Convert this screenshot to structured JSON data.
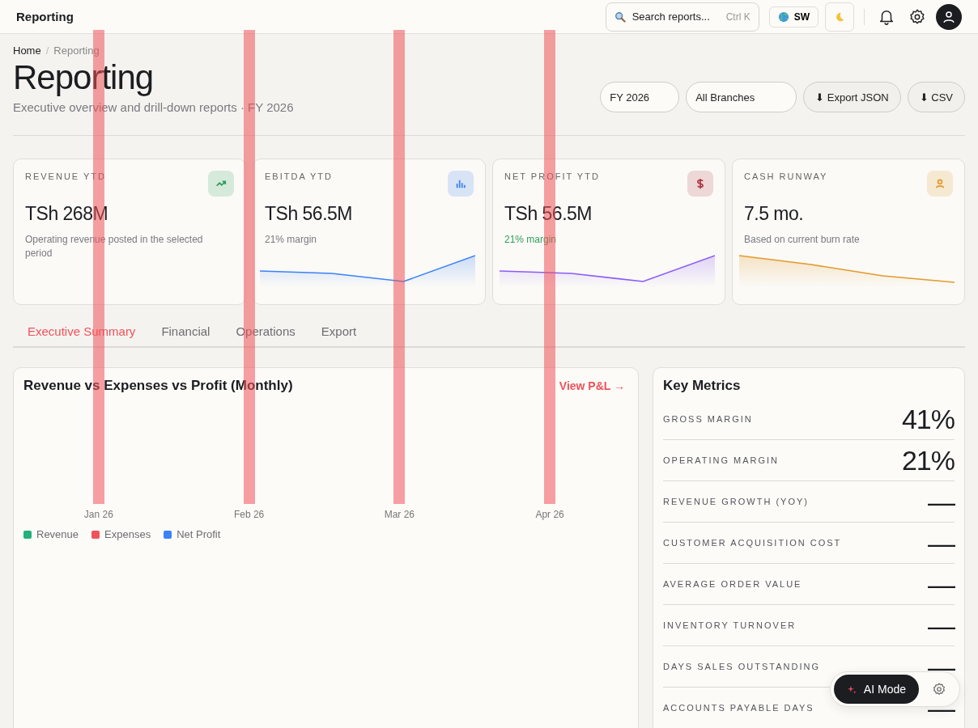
{
  "topbar": {
    "title": "Reporting",
    "search": {
      "placeholder": "Search reports...",
      "shortcut": "Ctrl K"
    },
    "language": "SW"
  },
  "breadcrumb": {
    "items": [
      "Home",
      "Reporting"
    ],
    "separator": "/"
  },
  "header": {
    "title": "Reporting",
    "subtitle": "Executive overview and drill-down reports · FY 2026",
    "filters": [
      "FY 2026",
      "All Branches"
    ],
    "actions": [
      "⬇ Export JSON",
      "⬇ CSV"
    ]
  },
  "cards": [
    {
      "label": "REVENUE YTD",
      "value": "TSh 268M",
      "note": "Operating revenue posted in the selected period",
      "positive": false,
      "color": "#2f9e5b"
    },
    {
      "label": "EBITDA YTD",
      "value": "TSh 56.5M",
      "note": "21% margin",
      "positive": false,
      "color": "#3b82f6"
    },
    {
      "label": "NET PROFIT YTD",
      "value": "TSh 56.5M",
      "note": "21% margin",
      "positive": true,
      "color": "#b23a48"
    },
    {
      "label": "CASH RUNWAY",
      "value": "7.5 mo.",
      "note": "Based on current burn rate",
      "positive": false,
      "color": "#e29a2b"
    }
  ],
  "tabs": [
    {
      "label": "Executive Summary",
      "selected": true
    },
    {
      "label": "Financial",
      "selected": false
    },
    {
      "label": "Operations",
      "selected": false
    },
    {
      "label": "Export",
      "selected": false
    }
  ],
  "chart": {
    "title": "Revenue vs Expenses vs Profit (Monthly)",
    "link": "View P&L →",
    "categories": [
      "Jan 26",
      "Feb 26",
      "Mar 26",
      "Apr 26"
    ],
    "legend": [
      {
        "name": "Revenue",
        "color": "#22b07d"
      },
      {
        "name": "Expenses",
        "color": "#f0525a"
      },
      {
        "name": "Net Profit",
        "color": "#3b82f6"
      }
    ]
  },
  "key_metrics": {
    "title": "Key Metrics",
    "rows": [
      {
        "label": "GROSS MARGIN",
        "value": "41%"
      },
      {
        "label": "OPERATING MARGIN",
        "value": "21%"
      },
      {
        "label": "REVENUE GROWTH (YOY)",
        "value": "—"
      },
      {
        "label": "CUSTOMER ACQUISITION COST",
        "value": "—"
      },
      {
        "label": "AVERAGE ORDER VALUE",
        "value": "—"
      },
      {
        "label": "INVENTORY TURNOVER",
        "value": "—"
      },
      {
        "label": "DAYS SALES OUTSTANDING",
        "value": "—"
      },
      {
        "label": "ACCOUNTS PAYABLE DAYS",
        "value": "—"
      }
    ]
  },
  "ai_mode": {
    "label": "AI Mode"
  }
}
